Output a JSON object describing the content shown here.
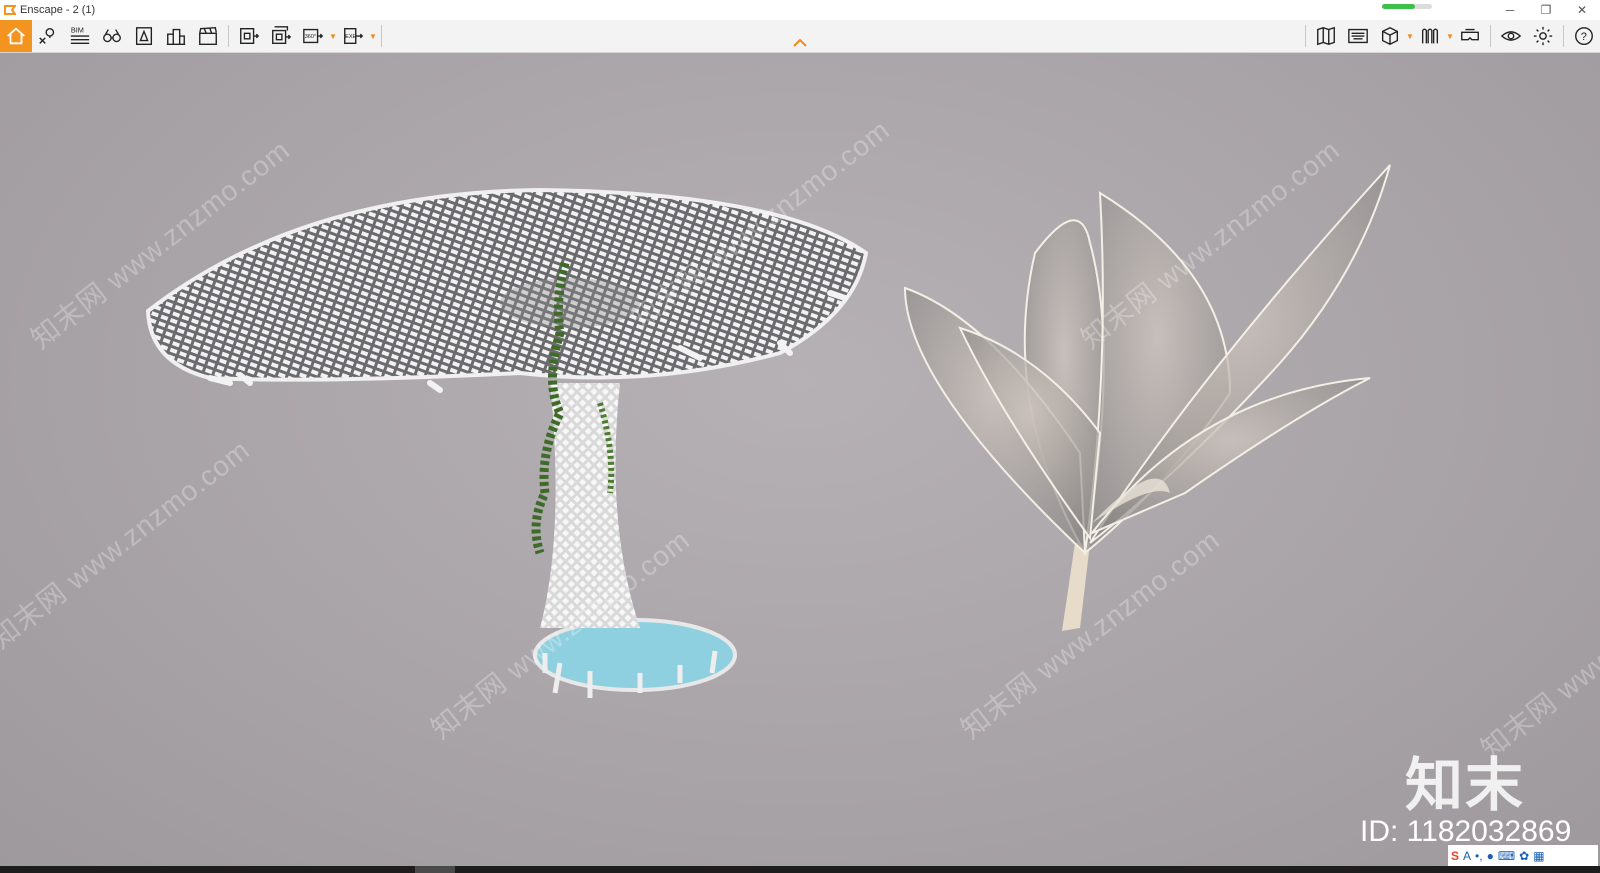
{
  "window": {
    "title": "Enscape - 2 (1)",
    "controls": [
      "minimize-icon",
      "restore-icon",
      "close-icon"
    ],
    "progress": 0.65,
    "progress_color": "#3cc04a"
  },
  "toolbar": {
    "accent_color": "#f39320",
    "left_buttons": [
      "home-icon",
      "location-pin-icon",
      "bim-icon",
      "binoculars-icon",
      "navigation-icon",
      "buildings-icon",
      "clapperboard-icon"
    ],
    "export_buttons": [
      "export-screenshot-icon",
      "batch-render-icon",
      "panorama-360-icon",
      "export-exe-icon"
    ],
    "bim_label": "BIM",
    "pano_label": "360°",
    "exe_label": "EXE",
    "right_buttons": [
      "map-icon",
      "keyboard-view-icon",
      "cube-icon",
      "ruler-icon",
      "vr-headset-icon",
      "eye-icon",
      "gear-icon",
      "help-icon"
    ]
  },
  "viewport": {
    "watermark_text": "知末网 www.znzmo.com",
    "brand_logo": "知末",
    "id_label": "ID: 1182032869"
  },
  "ime": {
    "logo": "S",
    "items": [
      "A",
      "•,",
      "mic-icon",
      "keyboard-icon",
      "skin-icon",
      "grid-icon"
    ]
  }
}
